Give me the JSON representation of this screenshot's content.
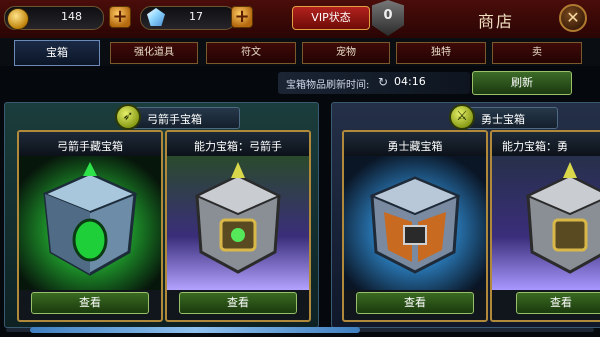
{
  "topbar": {
    "gold": {
      "icon": "gold-coin-icon",
      "value": "148"
    },
    "gems": {
      "icon": "diamond-icon",
      "value": "17"
    },
    "vip_label": "VIP状态",
    "vip_level": "0",
    "shop_title": "商店",
    "close_glyph": "✕"
  },
  "tabs": [
    {
      "label": "宝箱",
      "active": true
    },
    {
      "label": "强化道具",
      "active": false
    },
    {
      "label": "符文",
      "active": false
    },
    {
      "label": "宠物",
      "active": false
    },
    {
      "label": "独特",
      "active": false
    },
    {
      "label": "卖",
      "active": false
    }
  ],
  "refresh": {
    "label": "宝箱物品刷新时间:",
    "time": "04:16",
    "button_label": "刷新"
  },
  "sections": [
    {
      "title": "弓箭手宝箱",
      "icon": "archer-bow-icon",
      "cards": [
        {
          "title": "弓箭手藏宝箱",
          "button": "查看",
          "glow": "#39d35a"
        },
        {
          "title": "能力宝箱：弓箭手",
          "button": "查看",
          "glow": "#6f58c8"
        }
      ]
    },
    {
      "title": "勇士宝箱",
      "icon": "warrior-sword-icon",
      "cards": [
        {
          "title": "勇士藏宝箱",
          "button": "查看",
          "glow": "#3aa6e0"
        },
        {
          "title": "能力宝箱：勇",
          "button": "查看",
          "glow": "#6f58c8"
        }
      ]
    }
  ],
  "colors": {
    "topbar_red": "#4a0d0a",
    "gold_trim": "#b08a3a",
    "button_green": "#3a6a22",
    "tab_active_blue": "#1b2a45"
  }
}
